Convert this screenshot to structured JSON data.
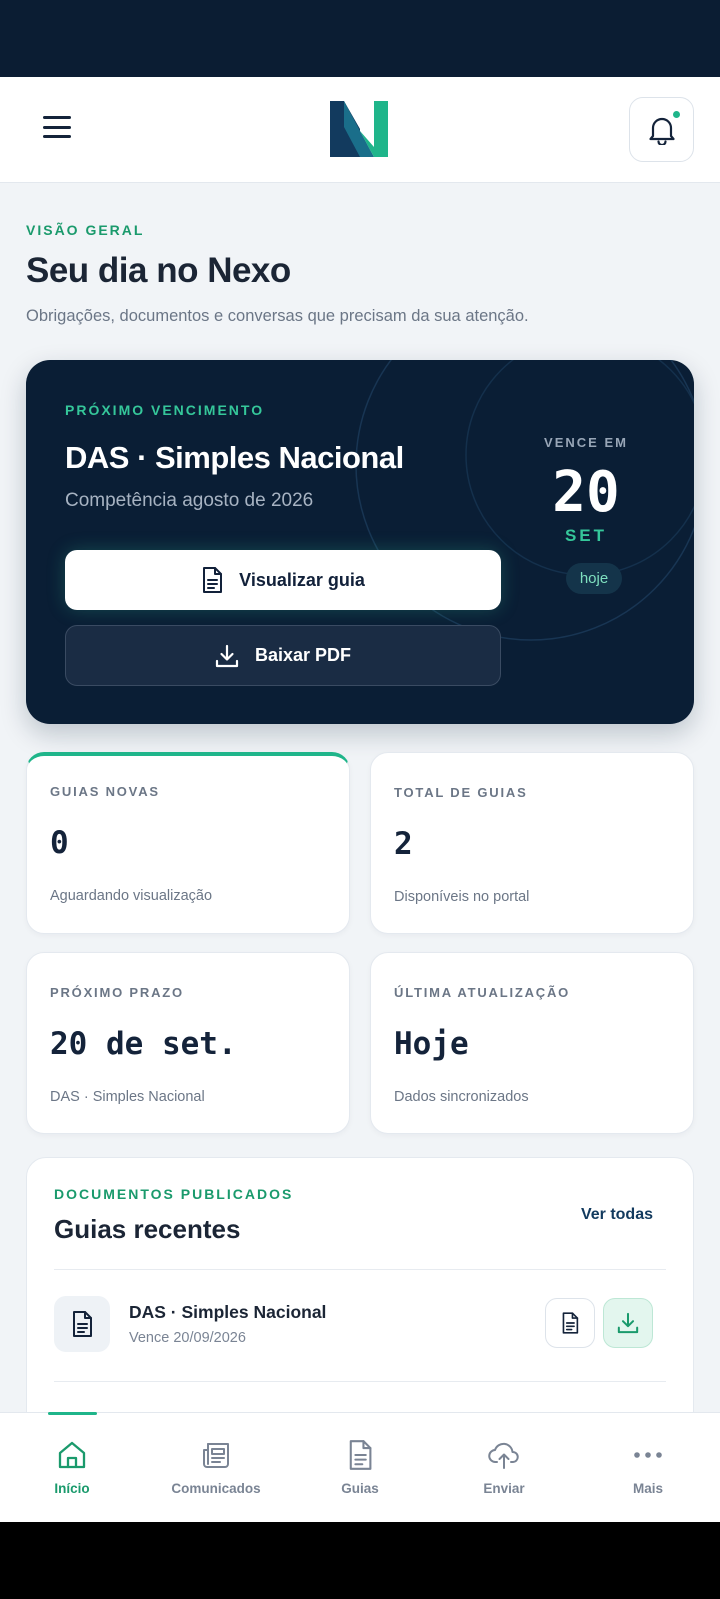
{
  "header": {
    "menu_icon": "hamburger-menu-icon",
    "logo_icon": "nexo-logo",
    "notification_icon": "bell-icon",
    "colors": {
      "brand_navy": "#0b1d33",
      "brand_green": "#1fb58a"
    }
  },
  "overview": {
    "eyebrow": "VISÃO GERAL",
    "title": "Seu dia no Nexo",
    "subtitle": "Obrigações, documentos e conversas que precisam da sua atenção."
  },
  "hero": {
    "eyebrow": "PRÓXIMO VENCIMENTO",
    "title": "DAS · Simples Nacional",
    "subtitle": "Competência agosto de 2026",
    "primary_button": "Visualizar guia",
    "primary_icon": "document-icon",
    "secondary_button": "Baixar PDF",
    "secondary_icon": "download-icon",
    "due_label": "VENCE EM",
    "due_day": "20",
    "due_month": "SET",
    "due_badge": "hoje"
  },
  "stats": [
    {
      "label": "GUIAS NOVAS",
      "value": "0",
      "note": "Aguardando visualização"
    },
    {
      "label": "TOTAL DE GUIAS",
      "value": "2",
      "note": "Disponíveis no portal"
    },
    {
      "label": "PRÓXIMO PRAZO",
      "value": "20 de set.",
      "note": "DAS · Simples Nacional"
    },
    {
      "label": "ÚLTIMA ATUALIZAÇÃO",
      "value": "Hoje",
      "note": "Dados sincronizados"
    }
  ],
  "documents": {
    "eyebrow": "DOCUMENTOS PUBLICADOS",
    "title": "Guias recentes",
    "see_all": "Ver todas",
    "items": [
      {
        "name": "DAS · Simples Nacional",
        "date": "Vence 20/09/2026"
      }
    ]
  },
  "nav": {
    "items": [
      {
        "label": "Início",
        "icon": "home-icon",
        "active": true
      },
      {
        "label": "Comunicados",
        "icon": "newspaper-icon",
        "active": false
      },
      {
        "label": "Guias",
        "icon": "document-icon",
        "active": false
      },
      {
        "label": "Enviar",
        "icon": "cloud-upload-icon",
        "active": false
      },
      {
        "label": "Mais",
        "icon": "more-dots-icon",
        "active": false
      }
    ]
  }
}
